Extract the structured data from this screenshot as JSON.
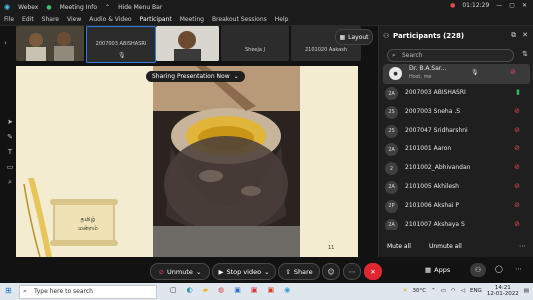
{
  "window": {
    "app_name": "Webex",
    "title_menus": [
      "Meeting Info",
      "Hide Menu Bar"
    ],
    "time": "01:12:29"
  },
  "menu": [
    "File",
    "Edit",
    "Share",
    "View",
    "Audio & Video",
    "Participant",
    "Meeting",
    "Breakout Sessions",
    "Help"
  ],
  "thumbnails": [
    {
      "name": ""
    },
    {
      "name": ""
    },
    {
      "name": "2007003 ABISHASRI"
    },
    {
      "name": ""
    },
    {
      "name": "Sheeja J"
    },
    {
      "name": "2101020 Aakash"
    }
  ],
  "layout_label": "Layout",
  "share_banner": "Sharing Presentation Now",
  "slide": {
    "scroll_text": "தமிழ் மன்றம்",
    "page_number": "11"
  },
  "participants_panel": {
    "title": "Participants (228)",
    "search_placeholder": "Search",
    "host": {
      "name": "Dr. B.A.Sar...",
      "role": "Host, me"
    },
    "list": [
      {
        "initials": "2A",
        "name": "2007003 ABISHASRI",
        "mic": "on"
      },
      {
        "initials": "2S",
        "name": "2007003 Sneha .S",
        "mic": "muted"
      },
      {
        "initials": "2S",
        "name": "2007047 Sridharshni",
        "mic": "muted"
      },
      {
        "initials": "2A",
        "name": "2101001 Aaron",
        "mic": "muted"
      },
      {
        "initials": "2",
        "name": "2101002_Abhivandan",
        "mic": "muted"
      },
      {
        "initials": "2A",
        "name": "2101005 Akhilesh",
        "mic": "muted"
      },
      {
        "initials": "2P",
        "name": "2101006 Akshai P",
        "mic": "muted"
      },
      {
        "initials": "2A",
        "name": "2101007 Akshaya S",
        "mic": "muted"
      }
    ],
    "mute_all": "Mute all",
    "unmute_all": "Unmute all"
  },
  "controls": {
    "unmute": "Unmute",
    "stop_video": "Stop video",
    "share": "Share",
    "apps": "Apps"
  },
  "taskbar": {
    "search_placeholder": "Type here to search",
    "weather": "30°C",
    "lang": "ENG",
    "time": "14:21",
    "date": "12-01-2022"
  },
  "colors": {
    "end_call": "#e0262f",
    "muted_mic": "#e14c4c",
    "active_mic": "#35b35a",
    "participant_highlight": "#3a3a3a"
  }
}
